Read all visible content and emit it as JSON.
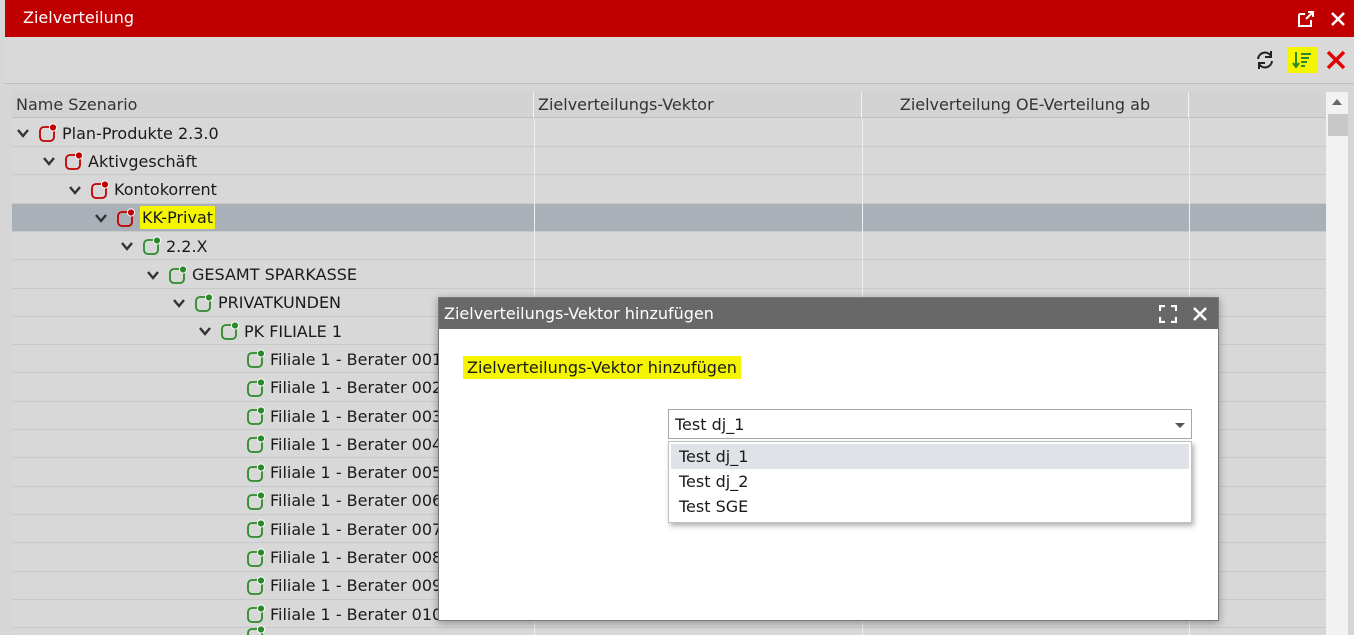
{
  "window": {
    "title": "Zielverteilung",
    "popout_icon": "popout-icon",
    "close_icon": "close-icon"
  },
  "toolbar": {
    "refresh_icon": "refresh-icon",
    "sort_icon": "sort-icon",
    "delete_icon": "delete-icon",
    "colors": {
      "delete": "#e00000",
      "sort_bg": "#f5f500",
      "sort_fg": "#2a8a2a"
    }
  },
  "grid": {
    "columns": [
      "Name Szenario",
      "Zielverteilungs-Vektor",
      "Zielverteilung OE-Verteilung ab"
    ],
    "rows": [
      {
        "label": "Plan-Produkte 2.3.0",
        "level": 0,
        "expanded": true,
        "status": "red"
      },
      {
        "label": "Aktivgeschäft",
        "level": 1,
        "expanded": true,
        "status": "red"
      },
      {
        "label": "Kontokorrent",
        "level": 2,
        "expanded": true,
        "status": "red"
      },
      {
        "label": "KK-Privat",
        "level": 3,
        "expanded": true,
        "status": "red",
        "selected": true,
        "highlighted": true
      },
      {
        "label": "2.2.X",
        "level": 4,
        "expanded": true,
        "status": "green"
      },
      {
        "label": "GESAMT SPARKASSE",
        "level": 5,
        "expanded": true,
        "status": "green"
      },
      {
        "label": "PRIVATKUNDEN",
        "level": 6,
        "expanded": true,
        "status": "green"
      },
      {
        "label": "PK FILIALE 1",
        "level": 7,
        "expanded": true,
        "status": "green"
      },
      {
        "label": "Filiale 1 - Berater 001",
        "level": 8,
        "leaf": true,
        "status": "green"
      },
      {
        "label": "Filiale 1 - Berater 002",
        "level": 8,
        "leaf": true,
        "status": "green"
      },
      {
        "label": "Filiale 1 - Berater 003",
        "level": 8,
        "leaf": true,
        "status": "green"
      },
      {
        "label": "Filiale 1 - Berater 004",
        "level": 8,
        "leaf": true,
        "status": "green"
      },
      {
        "label": "Filiale 1 - Berater 005",
        "level": 8,
        "leaf": true,
        "status": "green"
      },
      {
        "label": "Filiale 1 - Berater 006",
        "level": 8,
        "leaf": true,
        "status": "green"
      },
      {
        "label": "Filiale 1 - Berater 007",
        "level": 8,
        "leaf": true,
        "status": "green"
      },
      {
        "label": "Filiale 1 - Berater 008",
        "level": 8,
        "leaf": true,
        "status": "green"
      },
      {
        "label": "Filiale 1 - Berater 009",
        "level": 8,
        "leaf": true,
        "status": "green"
      },
      {
        "label": "Filiale 1 - Berater 010",
        "level": 8,
        "leaf": true,
        "status": "green"
      },
      {
        "label": "",
        "level": 8,
        "leaf": true,
        "status": "green"
      }
    ],
    "status_colors": {
      "red": "#c00000",
      "green": "#2a8a2a"
    }
  },
  "dialog": {
    "title": "Zielverteilungs-Vektor hinzufügen",
    "heading": "Zielverteilungs-Vektor hinzufügen",
    "maximize_icon": "maximize-icon",
    "close_icon": "close-icon",
    "select": {
      "value": "Test dj_1",
      "options": [
        "Test dj_1",
        "Test dj_2",
        "Test SGE"
      ],
      "active_option": "Test dj_1"
    }
  }
}
